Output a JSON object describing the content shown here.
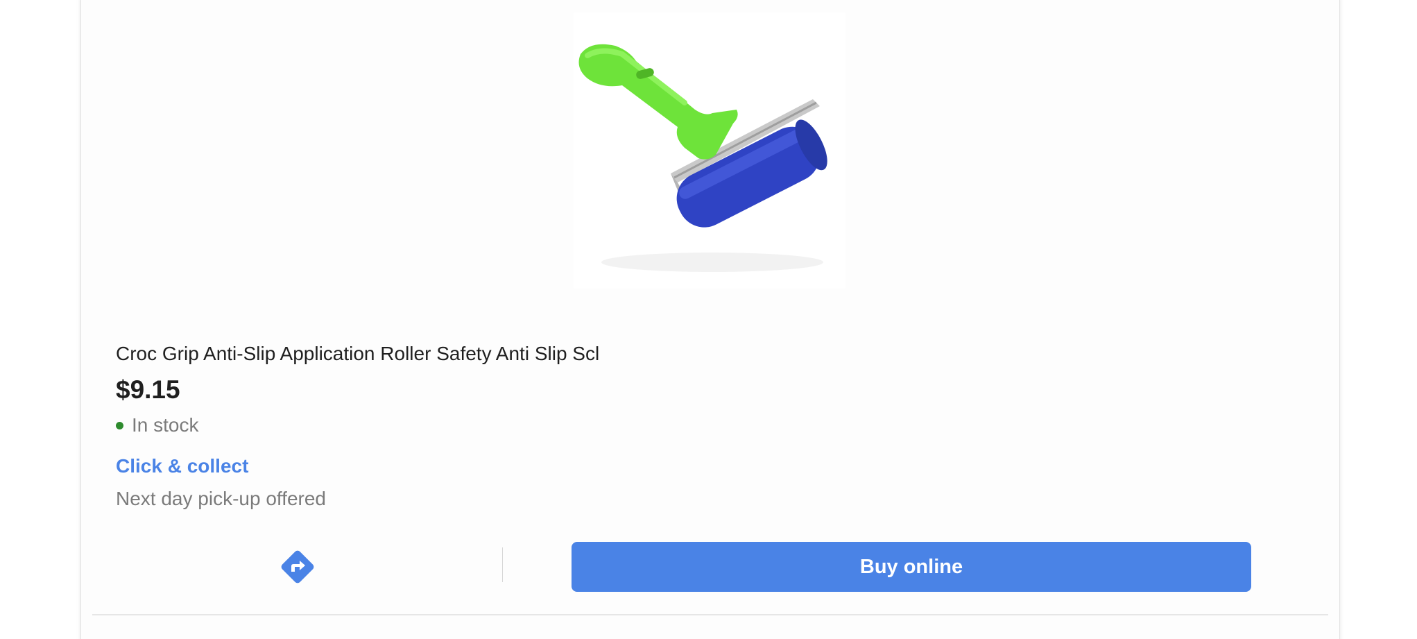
{
  "product": {
    "title": "Croc Grip Anti-Slip Application Roller Safety Anti Slip Scl",
    "price": "$9.15",
    "stock_status": "In stock",
    "image_icon": "roller-image"
  },
  "fulfillment": {
    "click_collect_label": "Click & collect",
    "pickup_note": "Next day pick-up offered"
  },
  "actions": {
    "directions_icon": "directions-icon",
    "buy_label": "Buy online"
  },
  "colors": {
    "accent": "#4a83e6",
    "stock_dot": "#2e8b2e"
  }
}
